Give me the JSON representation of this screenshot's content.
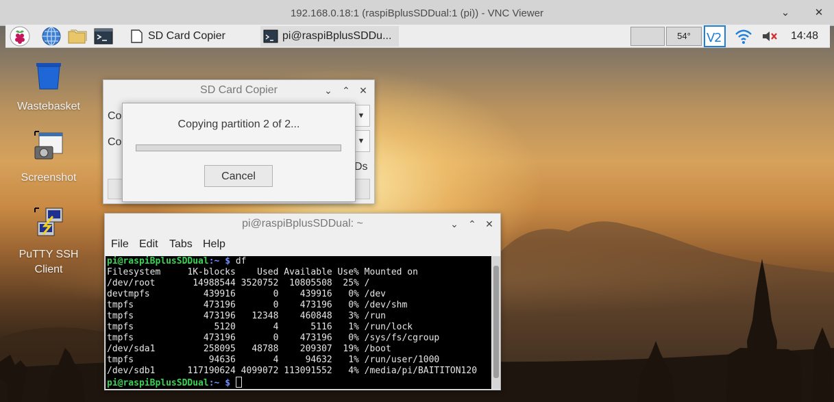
{
  "vnc": {
    "title": "192.168.0.18:1 (raspiBplusSDDual:1 (pi)) - VNC Viewer",
    "ctl_minimize": "⌄",
    "ctl_close": "✕"
  },
  "taskbar": {
    "tasks": [
      {
        "label": "SD Card Copier"
      },
      {
        "label": "pi@raspiBplusSDDu..."
      }
    ],
    "temperature": "54°",
    "clock": "14:48"
  },
  "desktop_icons": [
    {
      "label": "Wastebasket"
    },
    {
      "label": "Screenshot"
    },
    {
      "label": "PuTTY SSH Client",
      "line1": "PuTTY SSH",
      "line2": "Client"
    }
  ],
  "sd_copier": {
    "title": "SD Card Copier",
    "row1_label_partial": "Co",
    "row2_label_partial": "Co",
    "fragment_right": "Ds",
    "ctl_minimize": "⌄",
    "ctl_maximize": "⌃",
    "ctl_close": "✕"
  },
  "progress_dialog": {
    "message": "Copying partition 2 of 2...",
    "progress_fraction": 0.0,
    "cancel_label": "Cancel"
  },
  "terminal": {
    "title": "pi@raspiBplusSDDual: ~",
    "menu": [
      "File",
      "Edit",
      "Tabs",
      "Help"
    ],
    "prompt_user": "pi@raspiBplusSDDual",
    "prompt_path": ":~ $",
    "command": " df",
    "header": "Filesystem     1K-blocks    Used Available Use% Mounted on",
    "rows": [
      "/dev/root       14988544 3520752  10805508  25% /",
      "devtmpfs          439916       0    439916   0% /dev",
      "tmpfs             473196       0    473196   0% /dev/shm",
      "tmpfs             473196   12348    460848   3% /run",
      "tmpfs               5120       4      5116   1% /run/lock",
      "tmpfs             473196       0    473196   0% /sys/fs/cgroup",
      "/dev/sda1         258095   48788    209307  19% /boot",
      "tmpfs              94636       4     94632   1% /run/user/1000",
      "/dev/sdb1      117190624 4099072 113091552   4% /media/pi/BAITITON120"
    ],
    "ctl_minimize": "⌄",
    "ctl_maximize": "⌃",
    "ctl_close": "✕"
  },
  "colors": {
    "prompt_green": "#39d353",
    "prompt_blue": "#6f8fff",
    "vnc_blue": "#1d7fd6"
  }
}
